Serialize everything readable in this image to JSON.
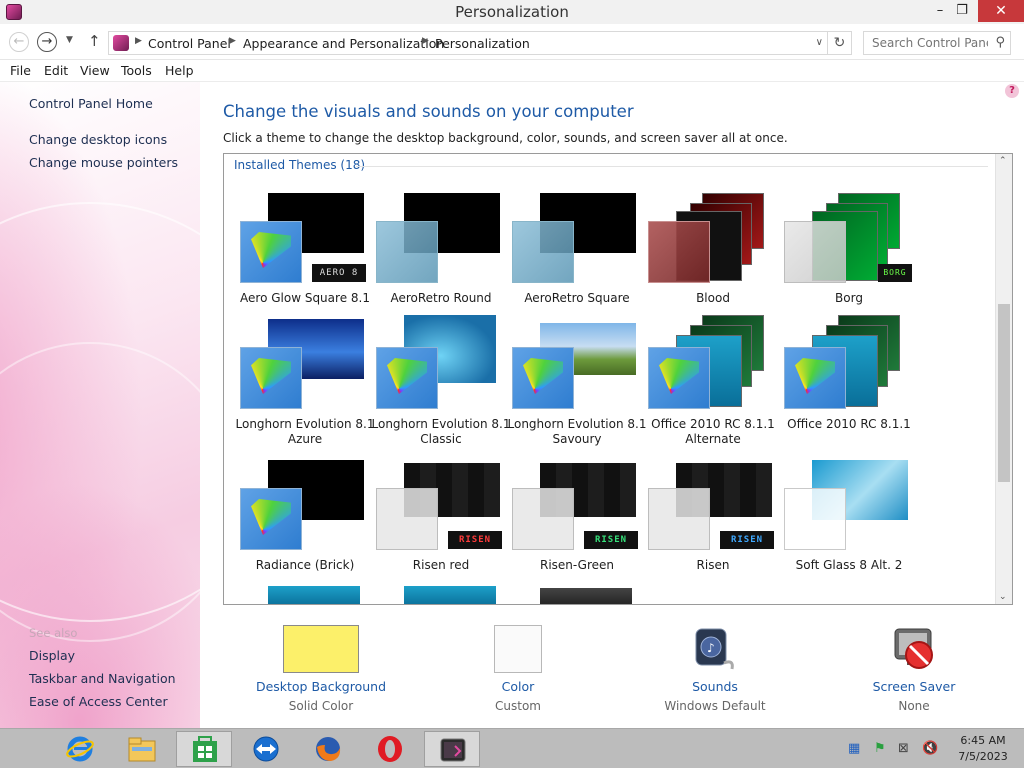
{
  "window": {
    "title": "Personalization",
    "min": "–",
    "max": "❐",
    "close": "✕"
  },
  "address": {
    "crumbs": [
      "Control Panel",
      "Appearance and Personalization",
      "Personalization"
    ],
    "search_placeholder": "Search Control Panel"
  },
  "menu": [
    "File",
    "Edit",
    "View",
    "Tools",
    "Help"
  ],
  "left": {
    "home": "Control Panel Home",
    "links": [
      "Change desktop icons",
      "Change mouse pointers"
    ],
    "see_also": "See also",
    "see_also_links": [
      "Display",
      "Taskbar and Navigation",
      "Ease of Access Center"
    ]
  },
  "main": {
    "heading": "Change the visuals and sounds on your computer",
    "subtext": "Click a theme to change the desktop background, color, sounds, and screen saver all at once.",
    "group_header": "Installed Themes (18)"
  },
  "themes": [
    {
      "name": "Aero Glow Square 8.1",
      "badge": "AERO 8"
    },
    {
      "name": "AeroRetro Round"
    },
    {
      "name": "AeroRetro Square"
    },
    {
      "name": "Blood"
    },
    {
      "name": "Borg",
      "badge": "BORG"
    },
    {
      "name": "Longhorn Evolution 8.1 Azure"
    },
    {
      "name": "Longhorn Evolution 8.1 Classic"
    },
    {
      "name": "Longhorn Evolution 8.1 Savoury"
    },
    {
      "name": "Office 2010 RC 8.1.1 Alternate"
    },
    {
      "name": "Office 2010 RC 8.1.1"
    },
    {
      "name": "Radiance (Brick)"
    },
    {
      "name": "Risen red",
      "badge": "RISEN"
    },
    {
      "name": "Risen-Green",
      "badge": "RISEN"
    },
    {
      "name": "Risen",
      "badge": "RISEN"
    },
    {
      "name": "Soft Glass 8 Alt. 2"
    }
  ],
  "settings": [
    {
      "label": "Desktop Background",
      "value": "Solid Color"
    },
    {
      "label": "Color",
      "value": "Custom"
    },
    {
      "label": "Sounds",
      "value": "Windows Default"
    },
    {
      "label": "Screen Saver",
      "value": "None"
    }
  ],
  "colors": {
    "desktop_background": "#fcf06a",
    "link": "#1e5aa6",
    "close_button": "#c7383b"
  },
  "taskbar": {
    "apps": [
      "internet-explorer-icon",
      "file-explorer-icon",
      "store-icon",
      "teamviewer-icon",
      "firefox-icon",
      "opera-icon",
      "personalization-app-icon"
    ],
    "time": "6:45 AM",
    "date": "7/5/2023"
  }
}
